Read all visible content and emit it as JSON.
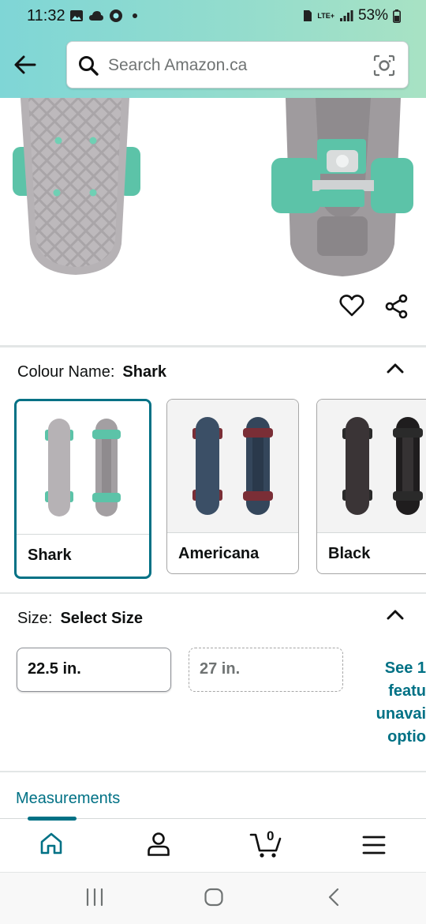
{
  "status_bar": {
    "time": "11:32",
    "network": "LTE+",
    "battery": "53%"
  },
  "header": {
    "search_placeholder": "Search Amazon.ca",
    "back_icon": "back-arrow-icon",
    "camera_icon": "camera-scan-icon"
  },
  "product": {
    "wishlist_icon": "heart-icon",
    "share_icon": "share-icon"
  },
  "colour": {
    "label": "Colour Name:",
    "selected": "Shark",
    "options": [
      {
        "label": "Shark",
        "selected": true
      },
      {
        "label": "Americana",
        "selected": false
      },
      {
        "label": "Black",
        "selected": false
      }
    ]
  },
  "size": {
    "label": "Size:",
    "selected": "Select Size",
    "options": [
      {
        "label": "22.5 in.",
        "available": true
      },
      {
        "label": "27 in.",
        "available": false
      }
    ],
    "see_unavailable_lines": [
      "See 1",
      "featu",
      "unavai",
      "optio"
    ]
  },
  "measurements": {
    "label": "Measurements"
  },
  "bottom_nav": {
    "items": [
      "home-icon",
      "account-icon",
      "cart-icon",
      "menu-icon"
    ],
    "cart_count": "0",
    "active": "home"
  },
  "colors": {
    "accent": "#007185",
    "header_gradient_start": "#7fd6d6",
    "header_gradient_end": "#a8e2c4"
  }
}
